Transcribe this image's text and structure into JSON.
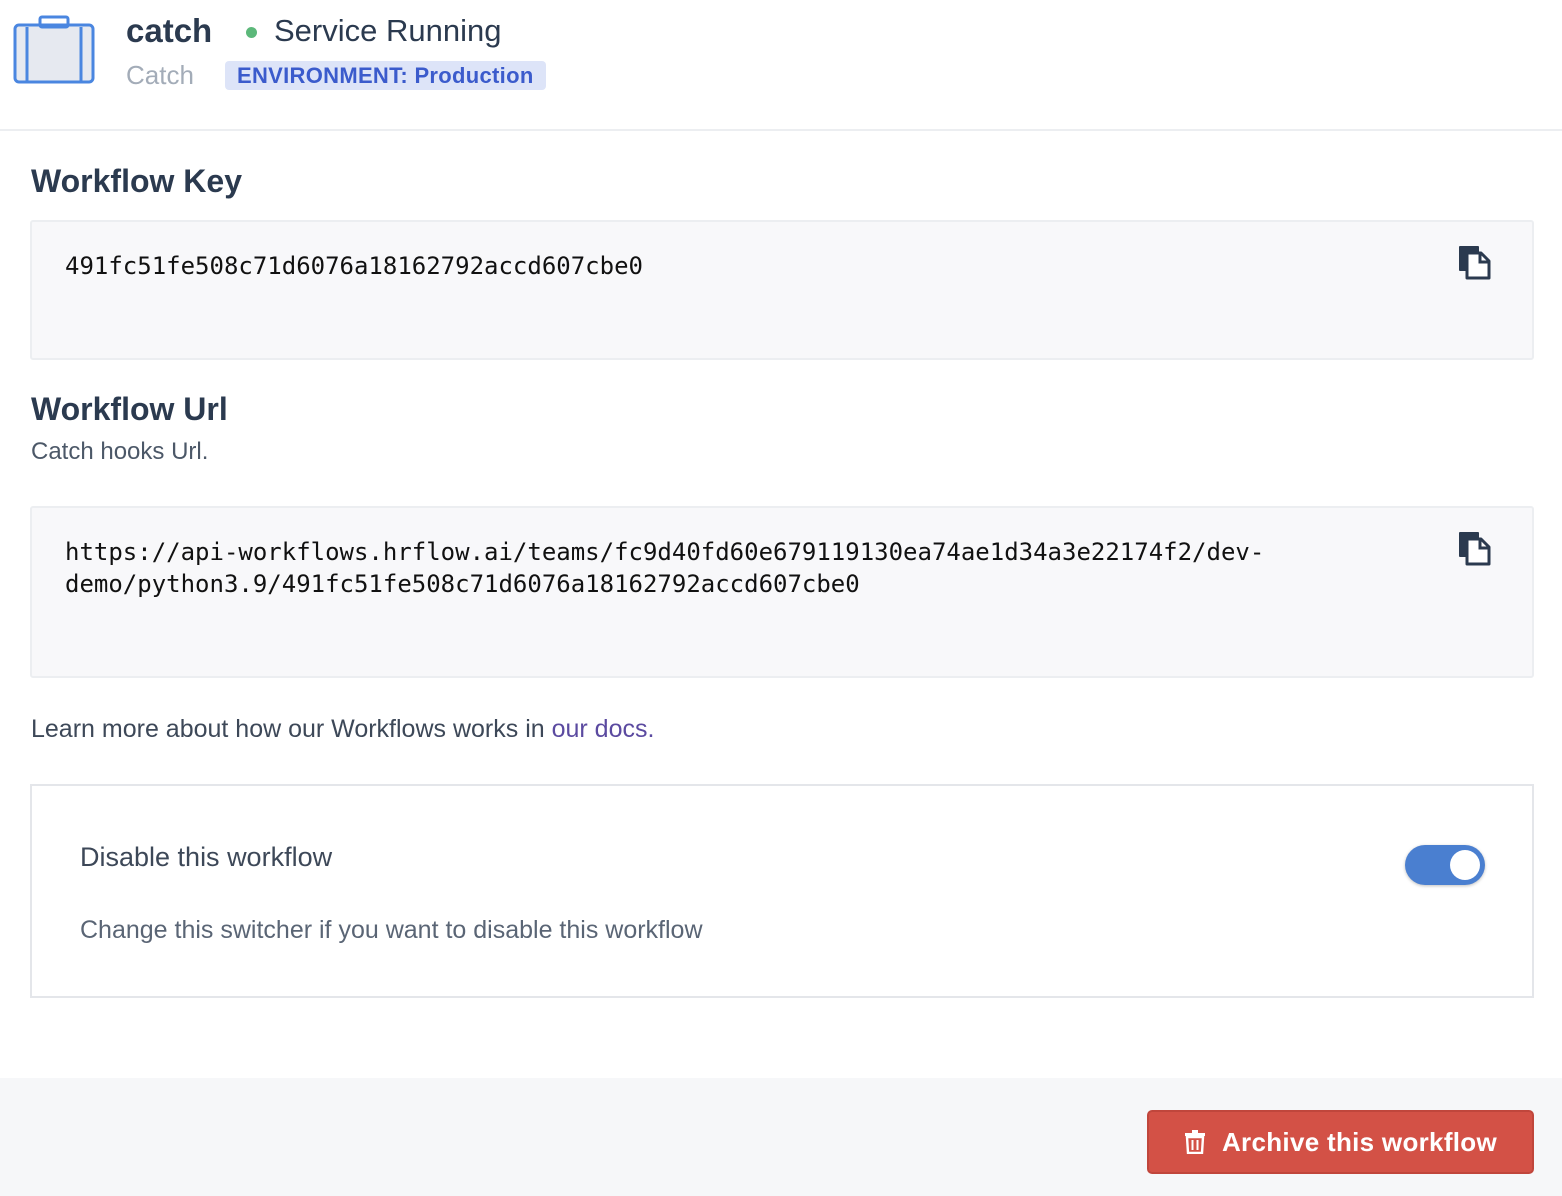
{
  "header": {
    "workflow_name": "catch",
    "status": "Service Running",
    "workflow_type": "Catch",
    "environment_badge": "ENVIRONMENT: Production",
    "icon": "briefcase-icon",
    "status_color": "#5cb87a"
  },
  "workflow_key": {
    "title": "Workflow Key",
    "value": "491fc51fe508c71d6076a18162792accd607cbe0",
    "copy_icon": "copy-icon"
  },
  "workflow_url": {
    "title": "Workflow Url",
    "subtitle": "Catch hooks Url.",
    "value_line1": "https://api-workflows.hrflow.ai/teams/fc9d40fd60e679119130ea74ae1d34a3e22174f2/dev-",
    "value_line2": "demo/python3.9/491fc51fe508c71d6076a18162792accd607cbe0",
    "copy_icon": "copy-icon"
  },
  "docs": {
    "prefix": "Learn more about how our Workflows works in ",
    "link_text": "our docs.",
    "link_color": "#5b4aa0"
  },
  "disable_card": {
    "title": "Disable this workflow",
    "description": "Change this switcher if you want to disable this workflow",
    "toggle_on": true,
    "toggle_color": "#4a7fd0"
  },
  "footer": {
    "archive_label": "Archive this workflow",
    "archive_icon": "trash-icon",
    "archive_color": "#d35146"
  }
}
